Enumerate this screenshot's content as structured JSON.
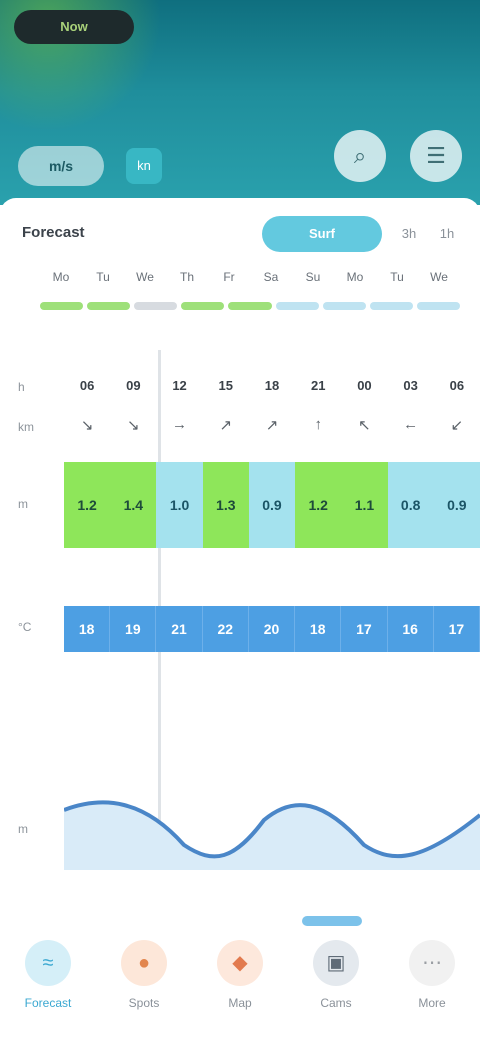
{
  "header": {
    "status_left": "Now",
    "status_right": "",
    "unit_label": "m/s",
    "unit_alt": "kn",
    "search_icon": "search-icon",
    "menu_icon": "menu-icon"
  },
  "card": {
    "title": "Forecast",
    "segments": [
      "Surf",
      "3h",
      "1h"
    ],
    "days": [
      "Mo",
      "Tu",
      "We",
      "Th",
      "Fr",
      "Sa",
      "Su",
      "Mo",
      "Tu",
      "We"
    ],
    "subtitle": "",
    "row_labels": {
      "hour": "h",
      "wind": "km",
      "wave": "m",
      "temp": "°C",
      "tide": "m"
    },
    "hours": [
      "06",
      "09",
      "12",
      "15",
      "18",
      "21",
      "00",
      "03",
      "06"
    ],
    "wind_dirs": [
      "↘",
      "↘",
      "→",
      "↗",
      "↗",
      "↑",
      "↖",
      "←",
      "↙"
    ],
    "waves": [
      {
        "v": "1.2",
        "c": "g"
      },
      {
        "v": "1.4",
        "c": "g"
      },
      {
        "v": "1.0",
        "c": "c"
      },
      {
        "v": "1.3",
        "c": "g"
      },
      {
        "v": "0.9",
        "c": "c"
      },
      {
        "v": "1.2",
        "c": "g"
      },
      {
        "v": "1.1",
        "c": "g"
      },
      {
        "v": "0.8",
        "c": "c"
      },
      {
        "v": "0.9",
        "c": "c"
      }
    ],
    "temps": [
      "18",
      "19",
      "21",
      "22",
      "20",
      "18",
      "17",
      "16",
      "17"
    ]
  },
  "nav": [
    {
      "label": "Forecast",
      "icon": "wave-icon"
    },
    {
      "label": "Spots",
      "icon": "pin-icon"
    },
    {
      "label": "Map",
      "icon": "map-icon"
    },
    {
      "label": "Cams",
      "icon": "camera-icon"
    },
    {
      "label": "More",
      "icon": "more-icon"
    }
  ],
  "colors": {
    "header_top": "#0f6f7f",
    "accent": "#63c9df",
    "good": "#8ee65a",
    "ok": "#a4e2ee",
    "temp": "#4d9fe3"
  }
}
